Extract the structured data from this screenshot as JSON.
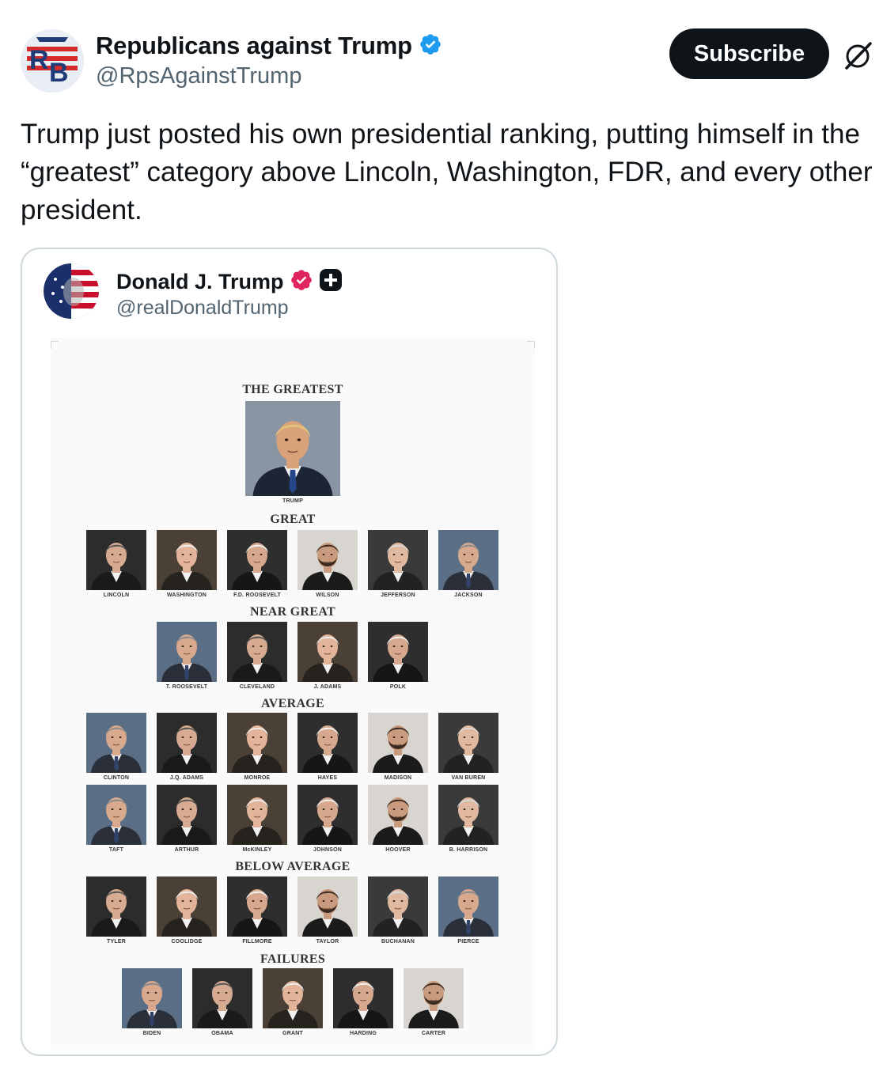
{
  "tweet": {
    "display_name": "Republicans against Trump",
    "handle": "@RpsAgainstTrump",
    "subscribe_label": "Subscribe",
    "text": "Trump just posted his own presidential ranking, putting himself in the “greatest” category above Lincoln, Washington, FDR, and every other president."
  },
  "embedded": {
    "display_name": "Donald J. Trump",
    "handle": "@realDonaldTrump"
  },
  "ranking": {
    "greatest_title": "THE GREATEST",
    "greatest": "TRUMP",
    "great_title": "GREAT",
    "great": [
      "LINCOLN",
      "WASHINGTON",
      "F.D. ROOSEVELT",
      "WILSON",
      "JEFFERSON",
      "JACKSON"
    ],
    "near_great_title": "NEAR GREAT",
    "near_great": [
      "T. ROOSEVELT",
      "CLEVELAND",
      "J. ADAMS",
      "POLK"
    ],
    "average_title": "AVERAGE",
    "average_row1": [
      "CLINTON",
      "J.Q. ADAMS",
      "MONROE",
      "HAYES",
      "MADISON",
      "VAN BUREN"
    ],
    "average_row2": [
      "TAFT",
      "ARTHUR",
      "McKINLEY",
      "JOHNSON",
      "HOOVER",
      "B. HARRISON"
    ],
    "below_average_title": "BELOW AVERAGE",
    "below_average": [
      "TYLER",
      "COOLIDGE",
      "FILLMORE",
      "TAYLOR",
      "BUCHANAN",
      "PIERCE"
    ],
    "failures_title": "FAILURES",
    "failures": [
      "BIDEN",
      "OBAMA",
      "GRANT",
      "HARDING",
      "CARTER"
    ]
  },
  "colors": {
    "verified_blue": "#1d9bf0",
    "verified_gold_red": "#e0245e",
    "text_primary": "#0f1419",
    "text_secondary": "#536471"
  }
}
